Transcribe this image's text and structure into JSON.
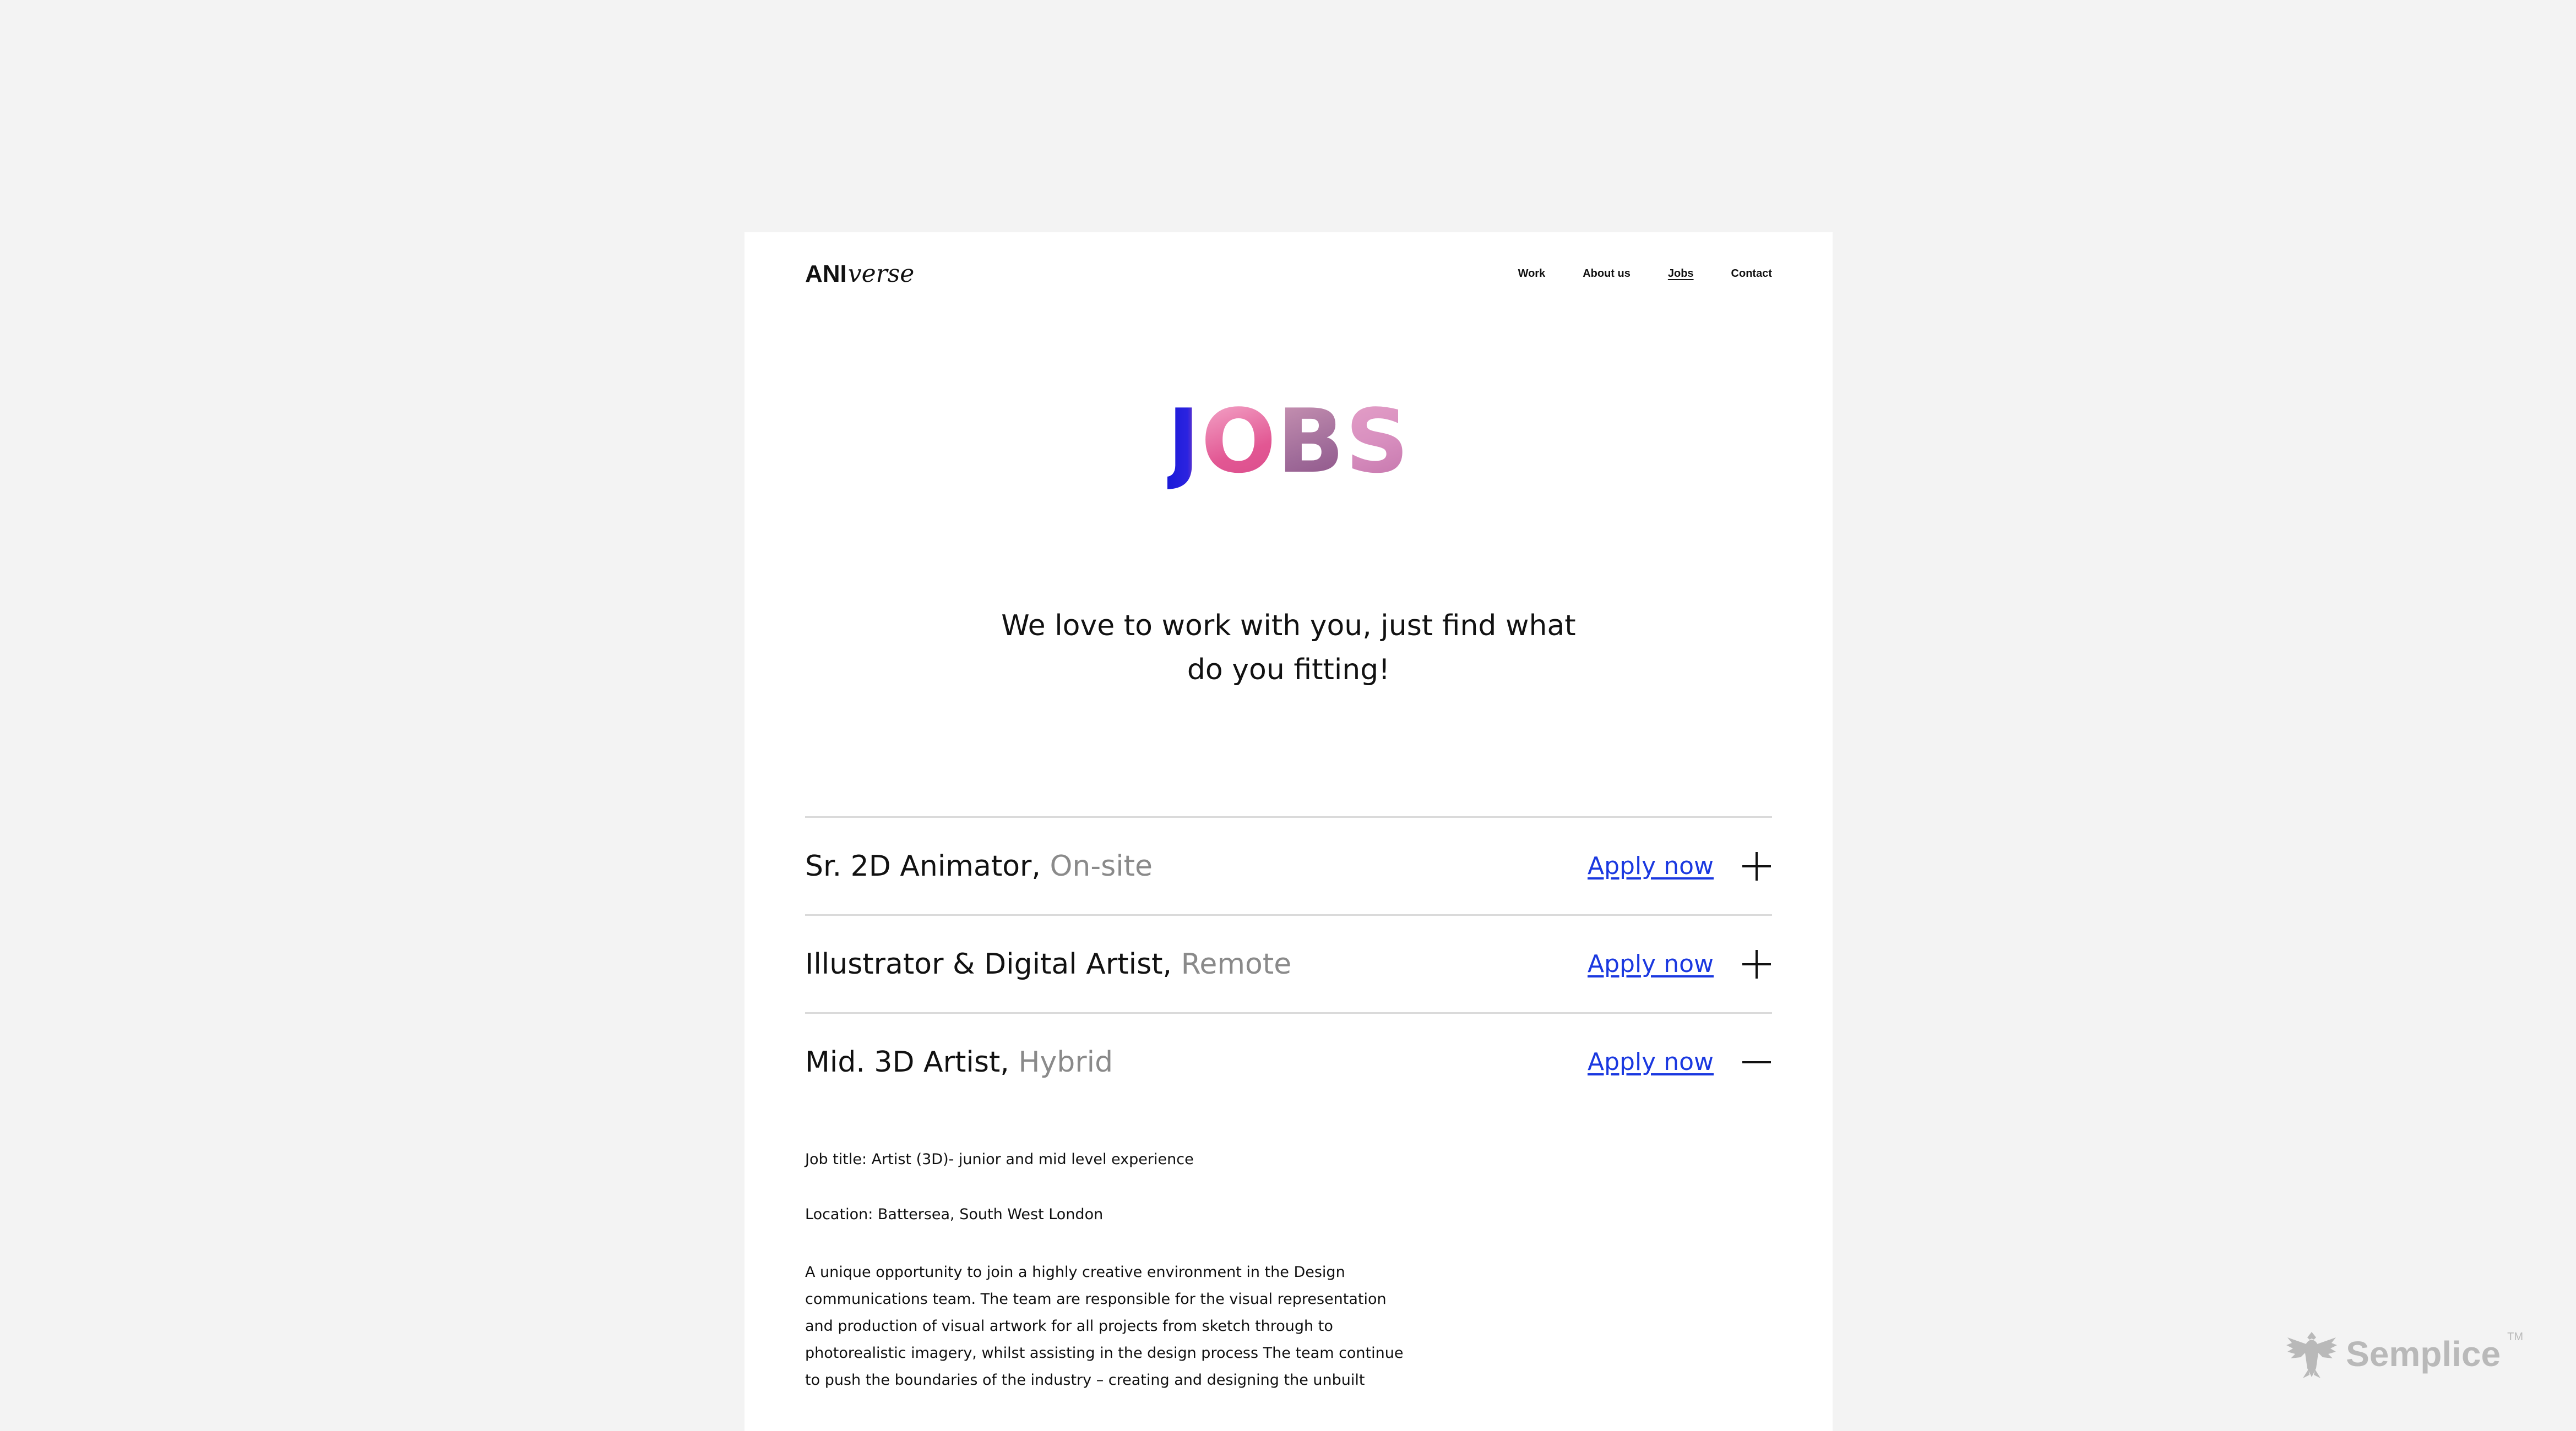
{
  "header": {
    "logo_bold": "ANI",
    "logo_script": "verse",
    "nav": [
      {
        "label": "Work",
        "active": false
      },
      {
        "label": "About us",
        "active": false
      },
      {
        "label": "Jobs",
        "active": true
      },
      {
        "label": "Contact",
        "active": false
      }
    ]
  },
  "hero": {
    "title_letters": [
      "J",
      "O",
      "B",
      "S"
    ]
  },
  "subtitle": {
    "line1": "We love to work with you, just find what",
    "line2": "do you fitting!"
  },
  "jobs": [
    {
      "title": "Sr. 2D Animator,",
      "type": "On-site",
      "apply": "Apply now",
      "expanded": false
    },
    {
      "title": "Illustrator & Digital Artist,",
      "type": "Remote",
      "apply": "Apply now",
      "expanded": false
    },
    {
      "title": "Mid. 3D Artist,",
      "type": "Hybrid",
      "apply": "Apply now",
      "expanded": true
    }
  ],
  "job_details": {
    "job_title": "Job title: Artist (3D)- junior and mid level experience",
    "location": "Location: Battersea, South West London",
    "description": "A unique opportunity to join a highly creative environment in the Design communications team. The team are responsible for the visual representation and production of visual artwork for all projects from sketch through to photorealistic imagery, whilst assisting in the design process The team continue to push the boundaries of the industry – creating and designing the unbuilt"
  },
  "branding": {
    "name": "Semplice",
    "tm": "TM",
    "icon": "eagle-icon"
  },
  "colors": {
    "background": "#f3f3f3",
    "card": "#ffffff",
    "link": "#1a38e0",
    "muted": "#8a8a8a"
  }
}
